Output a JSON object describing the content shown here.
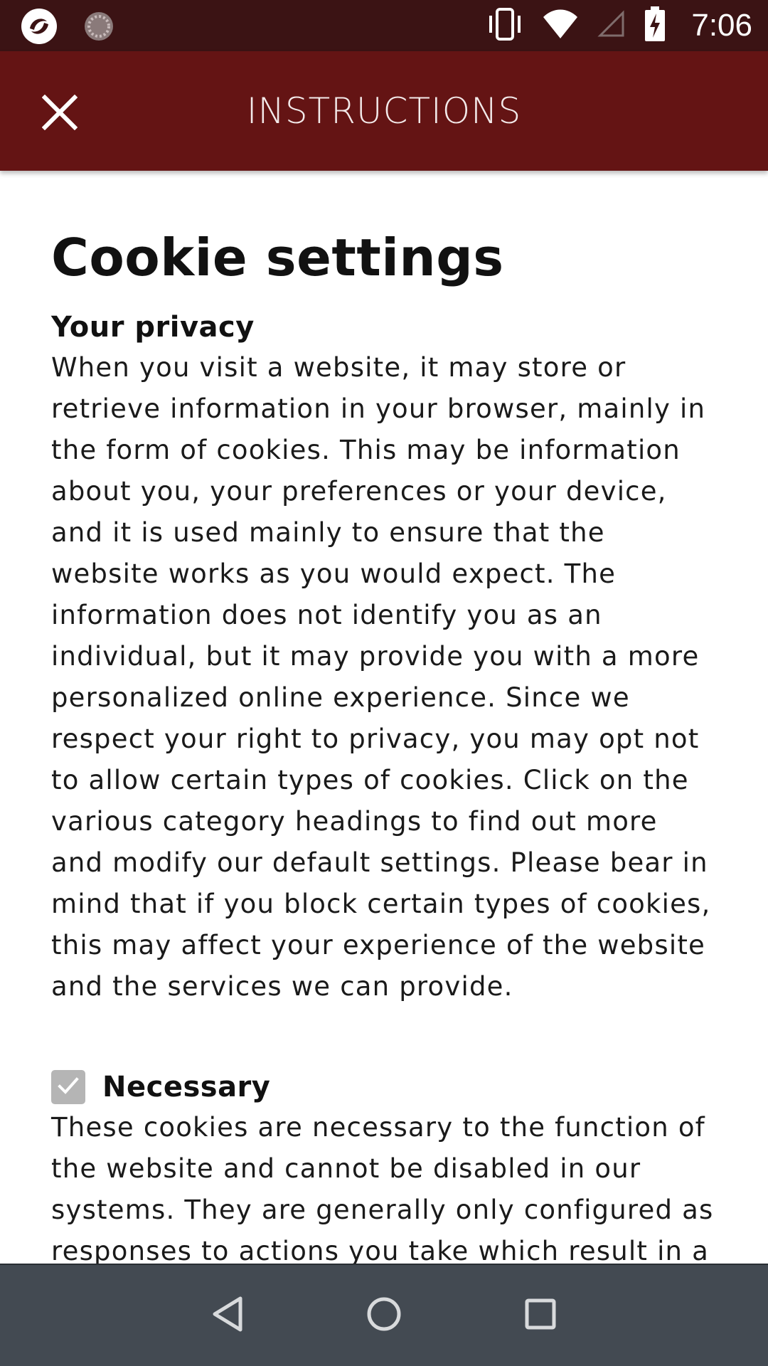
{
  "status_bar": {
    "time": "7:06",
    "icons": [
      "app-logo-icon",
      "loading-icon",
      "vibrate-icon",
      "wifi-icon",
      "cell-signal-icon",
      "battery-charging-icon"
    ]
  },
  "app_bar": {
    "title": "INSTRUCTIONS",
    "close_icon": "close-icon",
    "color": "#641414"
  },
  "content": {
    "heading": "Cookie settings",
    "privacy_heading": "Your privacy",
    "privacy_text": "When you visit a website, it may store or retrieve information in your browser, mainly in the form of cookies. This may be information about you, your preferences or your device, and it is used mainly to ensure that the website works as you would expect. The information does not identify you as an individual, but it may provide you with a more personalized online experience. Since we respect your right to privacy, you may opt not to allow certain types of cookies. Click on the various category headings to find out more and modify our default settings. Please bear in mind that if you block certain types of cookies, this may affect your experience of the website and the services we can provide.",
    "categories": [
      {
        "label": "Necessary",
        "checked": true,
        "disabled": true,
        "text": "These cookies are necessary to the function of the website and cannot be disabled in our systems. They are generally only configured as responses to actions you take which result in a query regarding services, such as entering your"
      }
    ]
  },
  "nav_bar": {
    "buttons": [
      "back-icon",
      "home-icon",
      "recents-icon"
    ]
  }
}
